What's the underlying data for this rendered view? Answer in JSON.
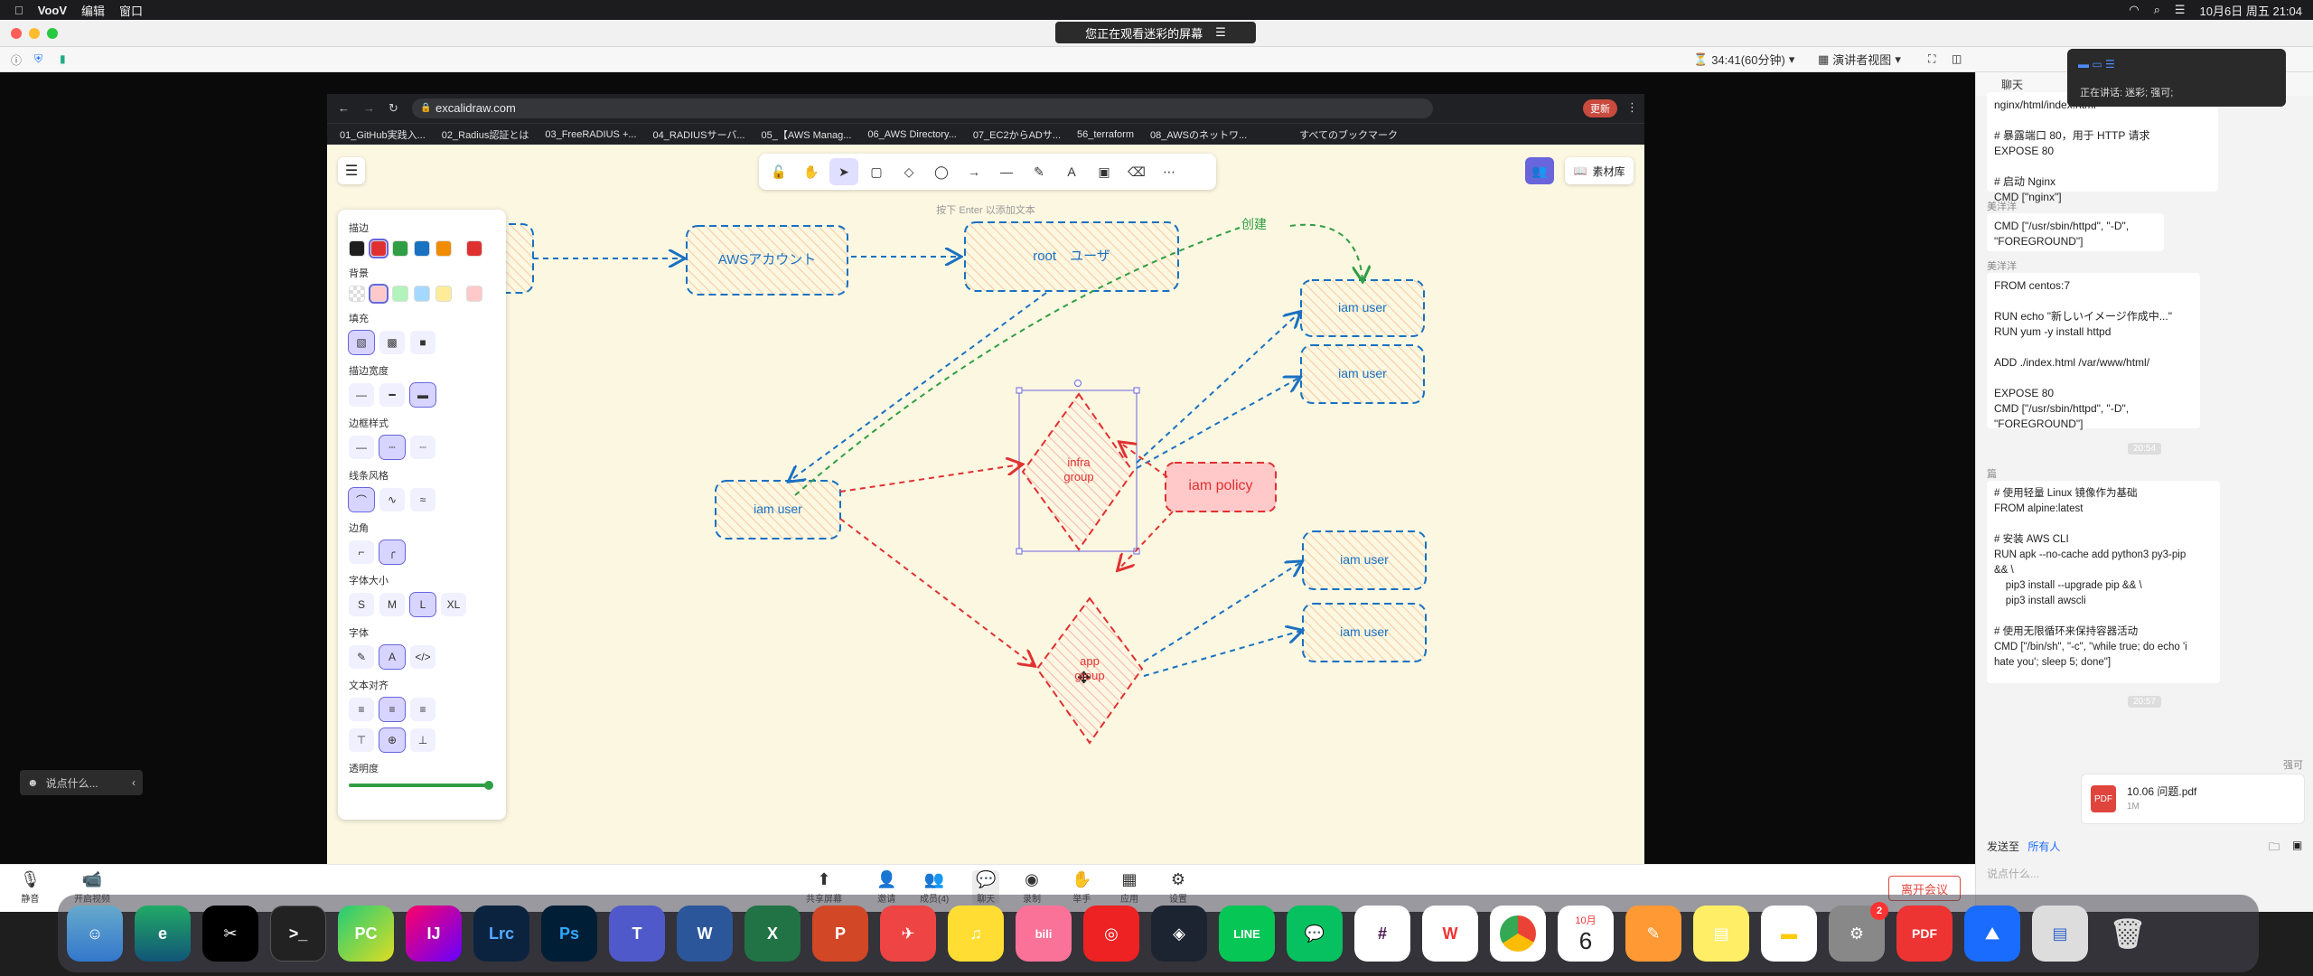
{
  "menubar": {
    "app_name": "VooV",
    "items": [
      "编辑",
      "窗口"
    ],
    "clock": "10月6日 周五 21:04"
  },
  "voov": {
    "watch_banner": "您正在观看迷彩的屏幕",
    "timer": "34:41(60分钟)",
    "view_mode": "演讲者视图",
    "speaking": "正在讲话: 迷彩; 强可;"
  },
  "browser": {
    "url": "excalidraw.com",
    "update_label": "更新",
    "bookmarks": [
      "01_GitHub実践入...",
      "02_Radius認証とは",
      "03_FreeRADIUS +...",
      "04_RADIUSサーバ...",
      "05_【AWS Manag...",
      "06_AWS Directory...",
      "07_EC2からADサ...",
      "56_terraform",
      "08_AWSのネットワ..."
    ],
    "all_bookmarks": "すべてのブックマーク"
  },
  "excalidraw": {
    "hint": "按下 Enter 以添加文本",
    "library_label": "素材库",
    "tools": [
      "lock",
      "hand",
      "select",
      "rectangle",
      "diamond",
      "ellipse",
      "arrow",
      "line",
      "draw",
      "text",
      "image",
      "eraser",
      "more"
    ],
    "props": {
      "stroke_label": "描边",
      "background_label": "背景",
      "fill_label": "填充",
      "stroke_width_label": "描边宽度",
      "stroke_style_label": "边框样式",
      "sloppiness_label": "线条风格",
      "edges_label": "边角",
      "font_size_label": "字体大小",
      "font_family_label": "字体",
      "text_align_label": "文本对齐",
      "opacity_label": "透明度",
      "font_sizes": [
        "S",
        "M",
        "L",
        "XL"
      ],
      "stroke_colors": [
        "#1e1e1e",
        "#e03131",
        "#2f9e44",
        "#1971c2",
        "#f08c00"
      ],
      "stroke_current": "#e03131",
      "bg_colors": [
        "transparent",
        "#ffc9c9",
        "#b2f2bb",
        "#a5d8ff",
        "#ffec99"
      ],
      "bg_current": "#ffc9c9"
    },
    "nodes": {
      "aws_account": "AWSアカウント",
      "root_user": "root　ユーザ",
      "create_label": "创建",
      "iam_user_1": "iam user",
      "iam_user_2": "iam user",
      "iam_user_3": "iam user",
      "iam_user_4": "iam user",
      "iam_user_5": "iam user",
      "infra_group": "infra\ngroup",
      "app_group": "app\ngroup",
      "iam_policy": "iam policy"
    }
  },
  "meeting_bar": {
    "mute": "静音",
    "video": "开启视频",
    "share": "共享屏幕",
    "invite": "邀请",
    "members": "成员(4)",
    "chat": "聊天",
    "record": "录制",
    "raise_hand": "举手",
    "apps": "应用",
    "settings": "设置",
    "leave": "离开会议",
    "say_something": "说点什么..."
  },
  "chat": {
    "header": "聊天",
    "messages": [
      {
        "sender": "",
        "text": "nginx/html/index.html\n\n# 暴露端口 80，用于 HTTP 请求\nEXPOSE 80\n\n# 启动 Nginx\nCMD [\"nginx\"]"
      },
      {
        "sender": "美洋洋",
        "text": "CMD [\"/usr/sbin/httpd\", \"-D\",\n\"FOREGROUND\"]"
      },
      {
        "sender": "美洋洋",
        "text": "FROM centos:7\n\nRUN echo \"新しいイメージ作成中...\"\nRUN yum -y install httpd\n\nADD ./index.html /var/www/html/\n\nEXPOSE 80\nCMD [\"/usr/sbin/httpd\", \"-D\",\n\"FOREGROUND\"]"
      },
      {
        "sender": "篇",
        "text": "# 使用轻量 Linux 镜像作为基础\nFROM alpine:latest\n\n# 安装 AWS CLI\nRUN apk --no-cache add python3 py3-pip\n&& \\\n    pip3 install --upgrade pip && \\\n    pip3 install awscli\n\n# 使用无限循环来保持容器活动\nCMD [\"/bin/sh\", \"-c\", \"while true; do echo 'i\nhate you'; sleep 5; done\"]"
      }
    ],
    "time_1": "20:54",
    "time_2": "20:57",
    "file_sender": "强可",
    "file_name": "10.06 问题.pdf",
    "file_size": "1M",
    "send_to_label": "发送至",
    "send_to_value": "所有人",
    "input_placeholder": "说点什么..."
  },
  "dock": {
    "calendar_month": "10月",
    "calendar_day": "6",
    "settings_badge": "2",
    "apps": [
      "Finder",
      "Edge",
      "CapCut",
      "Terminal",
      "PyCharm",
      "IntelliJ",
      "Lightroom",
      "Photoshop",
      "Teams",
      "Word",
      "Excel",
      "PowerPoint",
      "Mail",
      "Music",
      "Bilibili",
      "NetEase",
      "Zoom",
      "LINE",
      "WeChat",
      "Slack",
      "WPS",
      "Chrome",
      "Calendar",
      "Pages",
      "Stickies",
      "Notes",
      "Settings",
      "PDF",
      "VooV",
      "Files",
      "Trash"
    ]
  }
}
